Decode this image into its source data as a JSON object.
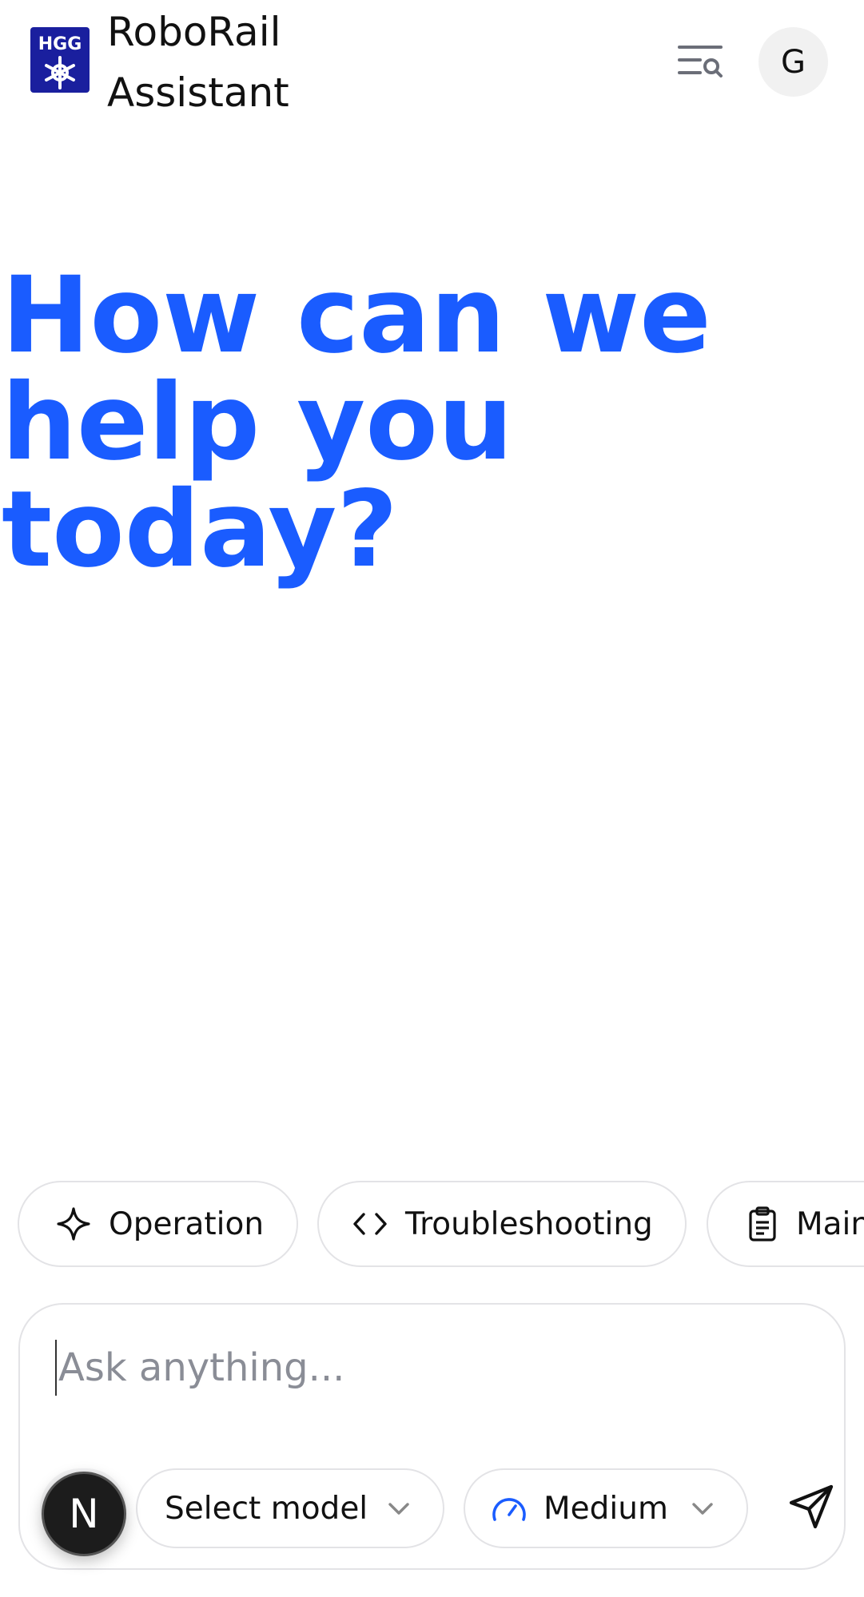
{
  "header": {
    "logo_text": "HGG",
    "title_line1": "RoboRail",
    "title_line2": "Assistant",
    "history_icon": "search-history-icon",
    "avatar_initial": "G"
  },
  "hero": {
    "heading": "How can we help you today?"
  },
  "suggestions": [
    {
      "label": "Operation",
      "icon": "sparkle-icon"
    },
    {
      "label": "Troubleshooting",
      "icon": "code-icon"
    },
    {
      "label": "Maintenance",
      "icon": "clipboard-icon"
    }
  ],
  "composer": {
    "placeholder": "Ask anything...",
    "value": "",
    "model_select_label": "Select model",
    "effort_label": "Medium",
    "effort_icon": "gauge-icon",
    "attach_icon": "paperclip-icon",
    "send_icon": "send-icon",
    "badge_letter": "N"
  },
  "colors": {
    "accent": "#1a5cff",
    "border": "#e3e3e6",
    "logo_blue": "#1a1f9e",
    "text": "#111111",
    "placeholder": "#8a8d96"
  }
}
